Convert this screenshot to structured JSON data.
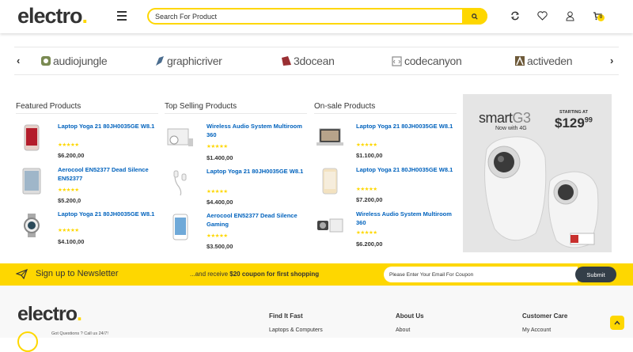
{
  "header": {
    "logo_text": "electro",
    "logo_dot": ".",
    "search_placeholder": "Search For Product",
    "cart_count": "0",
    "accent": "#fed700"
  },
  "brands": [
    {
      "name": "audiojungle",
      "icon": "audiojungle-icon"
    },
    {
      "name": "graphicriver",
      "icon": "graphicriver-icon"
    },
    {
      "name": "3docean",
      "icon": "3docean-icon"
    },
    {
      "name": "codecanyon",
      "icon": "codecanyon-icon"
    },
    {
      "name": "activeden",
      "icon": "activeden-icon"
    }
  ],
  "columns": [
    {
      "title": "Featured Products",
      "products": [
        {
          "title": "Laptop Yoga 21 80JH0035GE W8.1",
          "price": "$6.200,00",
          "thumb": "phone-rosegold"
        },
        {
          "title": "Aerocool EN52377 Dead Silence EN52377",
          "price": "$5.200,0",
          "thumb": "phone-silver"
        },
        {
          "title": "Laptop Yoga 21 80JH0035GE W8.1",
          "price": "$4.100,00",
          "thumb": "smartwatch"
        }
      ]
    },
    {
      "title": "Top Selling Products",
      "products": [
        {
          "title": "Wireless Audio System Multiroom 360",
          "price": "$1.400,00",
          "thumb": "console"
        },
        {
          "title": "Laptop Yoga 21 80JH0035GE W8.1",
          "price": "$4.400,00",
          "thumb": "earphones"
        },
        {
          "title": "Aerocool EN52377 Dead Silence Gaming",
          "price": "$3.500,00",
          "thumb": "tablet-white"
        }
      ]
    },
    {
      "title": "On-sale Products",
      "products": [
        {
          "title": "Laptop Yoga 21 80JH0035GE W8.1",
          "price": "$1.100,00",
          "thumb": "laptop"
        },
        {
          "title": "Laptop Yoga 21 80JH0035GE W8.1",
          "price": "$7.200,00",
          "thumb": "phone-gold"
        },
        {
          "title": "Wireless Audio System Multiroom 360",
          "price": "$6.200,00",
          "thumb": "camera"
        }
      ]
    }
  ],
  "stars": "★★★★★",
  "promo": {
    "brand": "smart",
    "brand_suffix": "G3",
    "tagline": "Now with 4G",
    "starting_at": "STARTING AT",
    "price_main": "$129",
    "price_cents": "99"
  },
  "newsletter": {
    "title": "Sign up to Newsletter",
    "text_pre": "...and receive ",
    "text_bold": "$20 coupon for first shopping",
    "placeholder": "Please Enter Your Email For Coupon",
    "button": "Submit"
  },
  "footer": {
    "logo_text": "electro",
    "logo_dot": ".",
    "questions": "Got Questions ? Call us 24/7!",
    "cols": [
      {
        "heading": "Find It Fast",
        "link": "Laptops & Computers"
      },
      {
        "heading": "About Us",
        "link": "About"
      },
      {
        "heading": "Customer Care",
        "link": "My Account"
      }
    ]
  }
}
